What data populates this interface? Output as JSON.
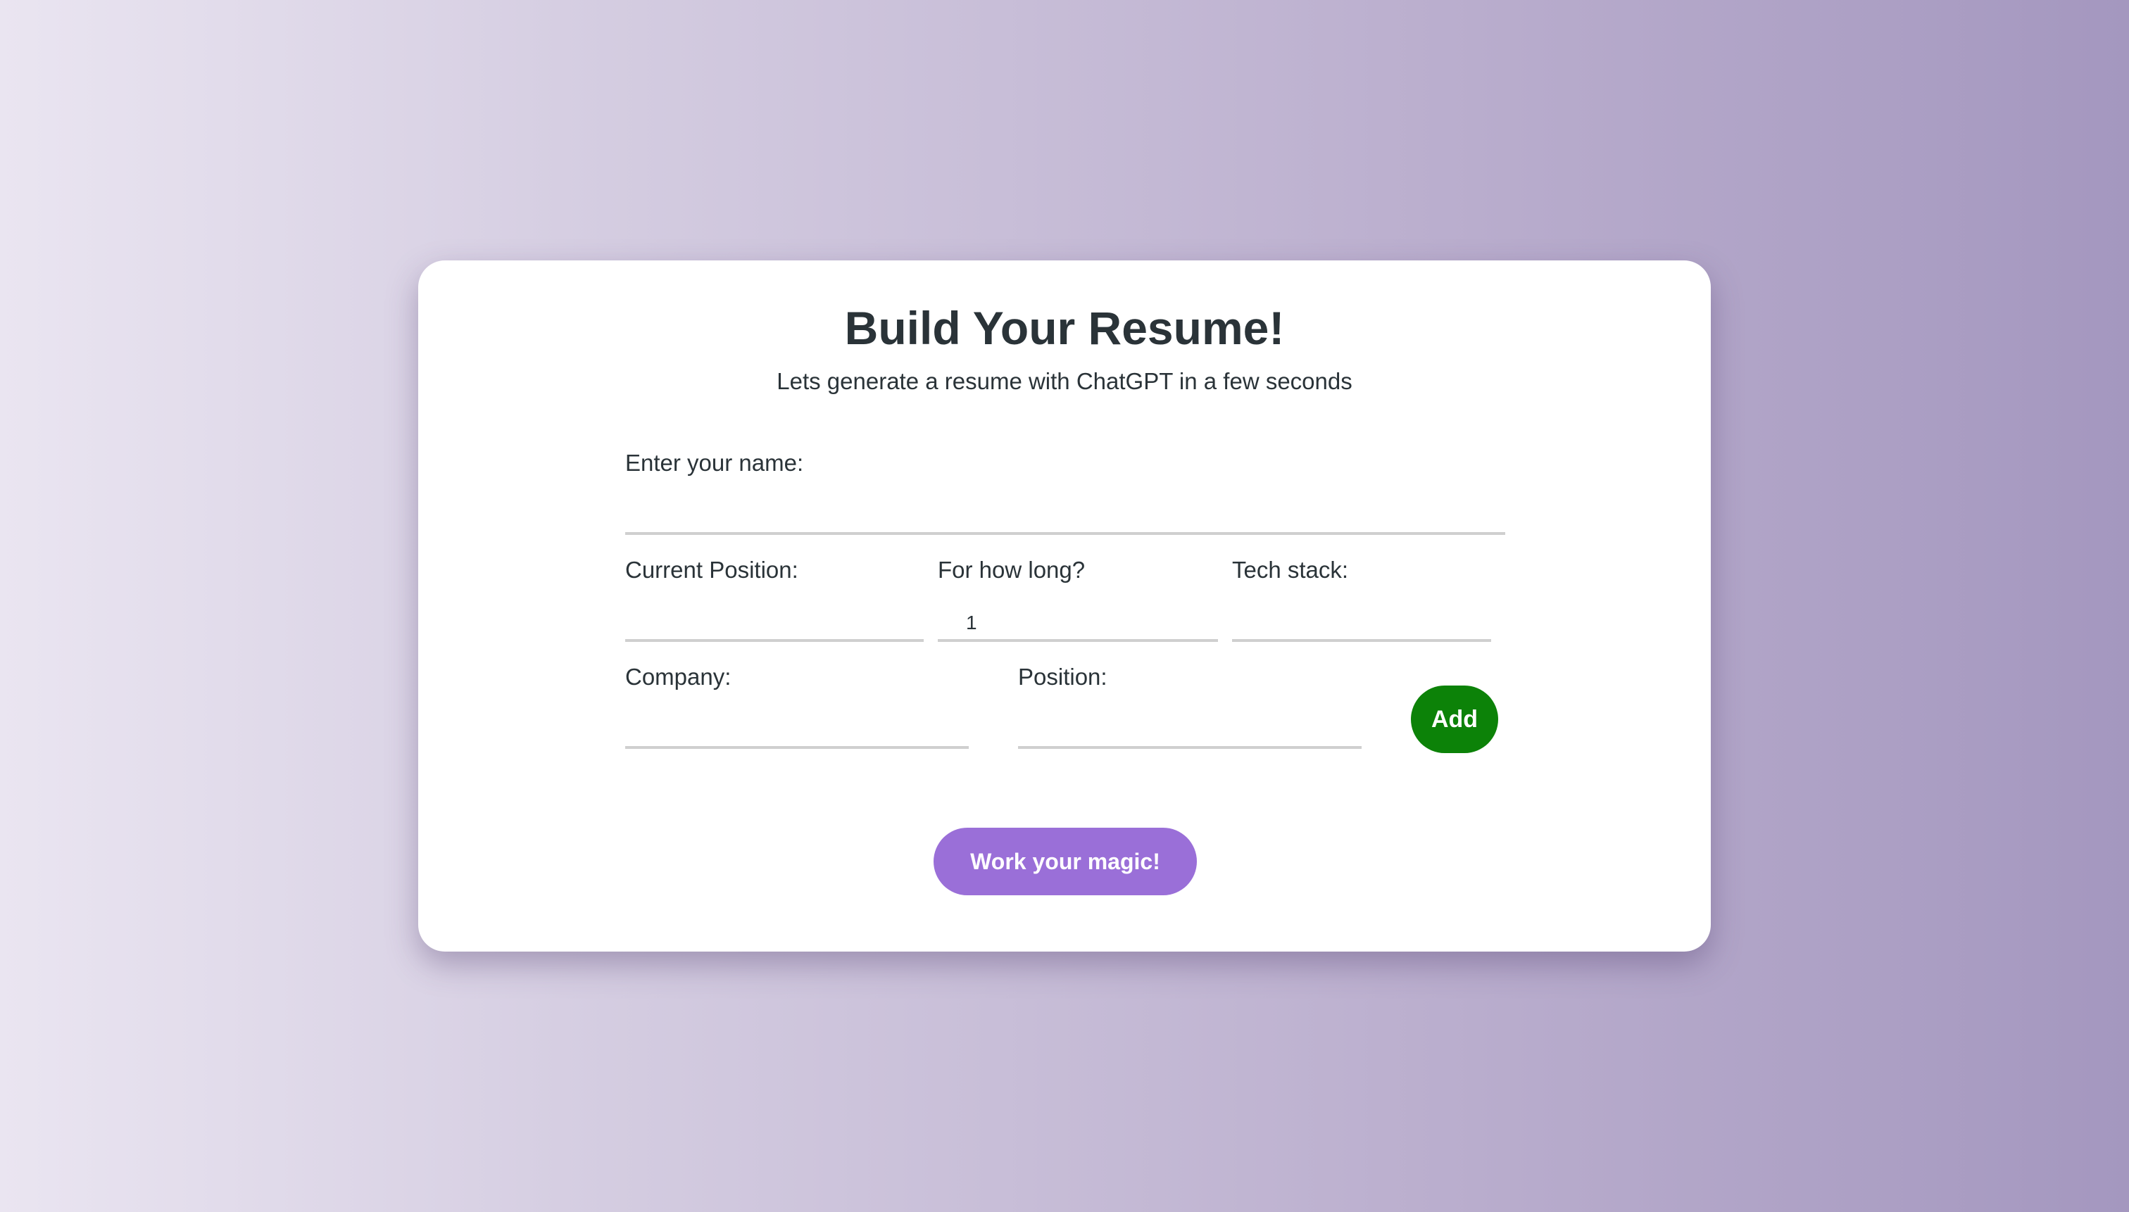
{
  "header": {
    "title": "Build Your Resume!",
    "subtitle": "Lets generate a resume with ChatGPT in a few seconds"
  },
  "form": {
    "name_label": "Enter your name:",
    "name_value": "",
    "current_position_label": "Current Position:",
    "current_position_value": "",
    "duration_label": "For how long?",
    "duration_value": "1",
    "tech_stack_label": "Tech stack:",
    "tech_stack_value": "",
    "company_label": "Company:",
    "company_value": "",
    "position_label": "Position:",
    "position_value": "",
    "add_label": "Add",
    "submit_label": "Work your magic!"
  },
  "colors": {
    "add_button": "#0c8208",
    "submit_button": "#9a6fd8",
    "background_start": "#eae5f1",
    "background_end": "#a497bf"
  }
}
